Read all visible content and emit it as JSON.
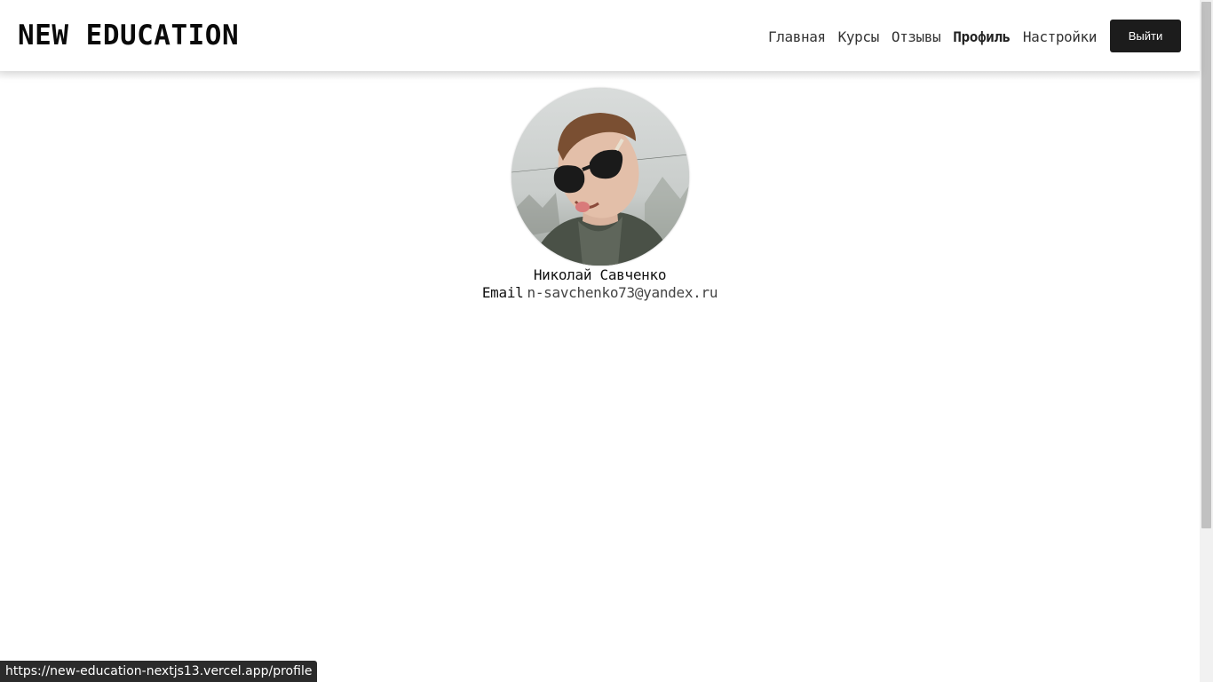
{
  "header": {
    "logo": "NEW EDUCATION",
    "nav": [
      {
        "label": "Главная",
        "active": false
      },
      {
        "label": "Курсы",
        "active": false
      },
      {
        "label": "Отзывы",
        "active": false
      },
      {
        "label": "Профиль",
        "active": true
      },
      {
        "label": "Настройки",
        "active": false
      }
    ],
    "logout_label": "Выйти"
  },
  "profile": {
    "name": "Николай Савченко",
    "email_label": "Email",
    "email": "n-savchenko73@yandex.ru",
    "avatar_icon": "user-photo"
  },
  "status_bar": {
    "url": "https://new-education-nextjs13.vercel.app/profile"
  },
  "colors": {
    "button_bg": "#1c1c1c",
    "text": "#111111",
    "status_bg": "#2b2b2b"
  }
}
